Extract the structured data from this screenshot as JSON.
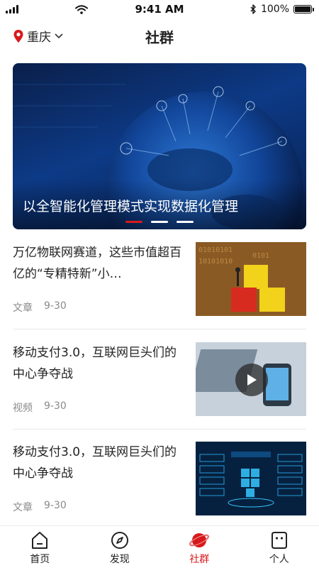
{
  "status_bar": {
    "time": "9:41 AM",
    "battery": "100%",
    "battery_level": 1.0
  },
  "header": {
    "location": "重庆",
    "title": "社群"
  },
  "banner": {
    "caption": "以全智能化管理模式实现数据化管理",
    "dots": 3,
    "active_dot": 0
  },
  "articles": [
    {
      "title": "万亿物联网赛道，这些市值超百亿的“专精特新”小…",
      "category": "文章",
      "date": "9-30",
      "is_video": false
    },
    {
      "title": "移动支付3.0，互联网巨头们的中心争夺战",
      "category": "视频",
      "date": "9-30",
      "is_video": true
    },
    {
      "title": "移动支付3.0，互联网巨头们的中心争夺战",
      "category": "文章",
      "date": "9-30",
      "is_video": false
    }
  ],
  "tabbar": {
    "items": [
      {
        "label": "首页",
        "icon": "home-icon"
      },
      {
        "label": "发现",
        "icon": "compass-icon"
      },
      {
        "label": "社群",
        "icon": "planet-icon",
        "active": true
      },
      {
        "label": "个人",
        "icon": "profile-icon"
      }
    ]
  },
  "colors": {
    "accent": "#d7191c",
    "meta": "#8a8a8a",
    "divider": "#e8e8e8"
  }
}
